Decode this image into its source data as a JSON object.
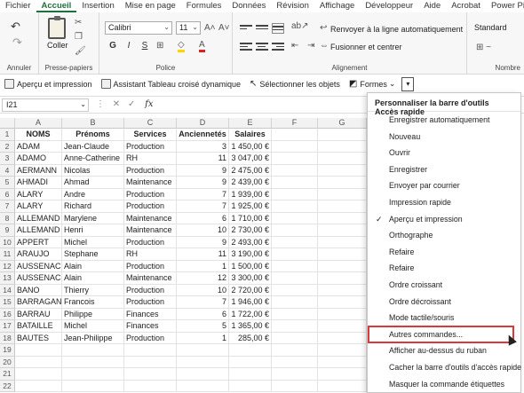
{
  "menubar": {
    "tabs": [
      "Fichier",
      "Accueil",
      "Insertion",
      "Mise en page",
      "Formules",
      "Données",
      "Révision",
      "Affichage",
      "Développeur",
      "Aide",
      "Acrobat",
      "Power Pivot"
    ]
  },
  "ribbon": {
    "groups": {
      "annuler": "Annuler",
      "presse_papiers": "Presse-papiers",
      "police": "Police",
      "alignement": "Alignement",
      "nombre": "Nombre"
    },
    "paste_label": "Coller",
    "font_name": "Calibri",
    "font_size": "11",
    "bold": "G",
    "italic": "I",
    "underline": "S",
    "wrap_text": "Renvoyer à la ligne automatiquement",
    "merge_center": "Fusionner et centrer",
    "number_format": "Standard"
  },
  "qat": {
    "buttons": [
      "Aperçu et impression",
      "Assistant Tableau croisé dynamique",
      "Sélectionner les objets",
      "Formes"
    ]
  },
  "formula_bar": {
    "name_box": "I21",
    "fx": "fx"
  },
  "sheet": {
    "columns": [
      "A",
      "B",
      "C",
      "D",
      "E",
      "F",
      "G"
    ],
    "rows": [
      "1",
      "2",
      "3",
      "4",
      "5",
      "6",
      "7",
      "8",
      "9",
      "10",
      "11",
      "12",
      "13",
      "14",
      "15",
      "16",
      "17",
      "18",
      "19",
      "20",
      "21",
      "22"
    ],
    "headers": [
      "NOMS",
      "Prénoms",
      "Services",
      "Anciennetés",
      "Salaires"
    ],
    "data": [
      [
        "ADAM",
        "Jean-Claude",
        "Production",
        "3",
        "1 450,00 €"
      ],
      [
        "ADAMO",
        "Anne-Catherine",
        "RH",
        "11",
        "3 047,00 €"
      ],
      [
        "AERMANN",
        "Nicolas",
        "Production",
        "9",
        "2 475,00 €"
      ],
      [
        "AHMADI",
        "Ahmad",
        "Maintenance",
        "9",
        "2 439,00 €"
      ],
      [
        "ALARY",
        "Andre",
        "Production",
        "7",
        "1 939,00 €"
      ],
      [
        "ALARY",
        "Richard",
        "Production",
        "7",
        "1 925,00 €"
      ],
      [
        "ALLEMAND",
        "Marylene",
        "Maintenance",
        "6",
        "1 710,00 €"
      ],
      [
        "ALLEMAND",
        "Henri",
        "Maintenance",
        "10",
        "2 730,00 €"
      ],
      [
        "APPERT",
        "Michel",
        "Production",
        "9",
        "2 493,00 €"
      ],
      [
        "ARAUJO",
        "Stephane",
        "RH",
        "11",
        "3 190,00 €"
      ],
      [
        "AUSSENAC",
        "Alain",
        "Production",
        "1",
        "1 500,00 €"
      ],
      [
        "AUSSENAC",
        "Alain",
        "Maintenance",
        "12",
        "3 300,00 €"
      ],
      [
        "BANO",
        "Thierry",
        "Production",
        "10",
        "2 720,00 €"
      ],
      [
        "BARRAGAN",
        "Francois",
        "Production",
        "7",
        "1 946,00 €"
      ],
      [
        "BARRAU",
        "Philippe",
        "Finances",
        "6",
        "1 722,00 €"
      ],
      [
        "BATAILLE",
        "Michel",
        "Finances",
        "5",
        "1 365,00 €"
      ],
      [
        "BAUTES",
        "Jean-Philippe",
        "Production",
        "1",
        "285,00 €"
      ]
    ]
  },
  "menu": {
    "title": "Personnaliser la barre d'outils Accès rapide",
    "items": [
      {
        "label": "Enregistrer automatiquement",
        "checked": false
      },
      {
        "label": "Nouveau",
        "checked": false
      },
      {
        "label": "Ouvrir",
        "checked": false
      },
      {
        "label": "Enregistrer",
        "checked": false
      },
      {
        "label": "Envoyer par courrier",
        "checked": false
      },
      {
        "label": "Impression rapide",
        "checked": false
      },
      {
        "label": "Aperçu et impression",
        "checked": true
      },
      {
        "label": "Orthographe",
        "checked": false
      },
      {
        "label": "Refaire",
        "checked": false
      },
      {
        "label": "Refaire",
        "checked": false
      },
      {
        "label": "Ordre croissant",
        "checked": false
      },
      {
        "label": "Ordre décroissant",
        "checked": false
      },
      {
        "label": "Mode tactile/souris",
        "checked": false
      },
      {
        "label": "Autres commandes...",
        "checked": false
      },
      {
        "label": "Afficher au-dessus du ruban",
        "checked": false
      },
      {
        "label": "Cacher la barre d'outils d'accès rapide",
        "checked": false
      },
      {
        "label": "Masquer la commande étiquettes",
        "checked": false
      }
    ],
    "check_mark": "✓"
  }
}
